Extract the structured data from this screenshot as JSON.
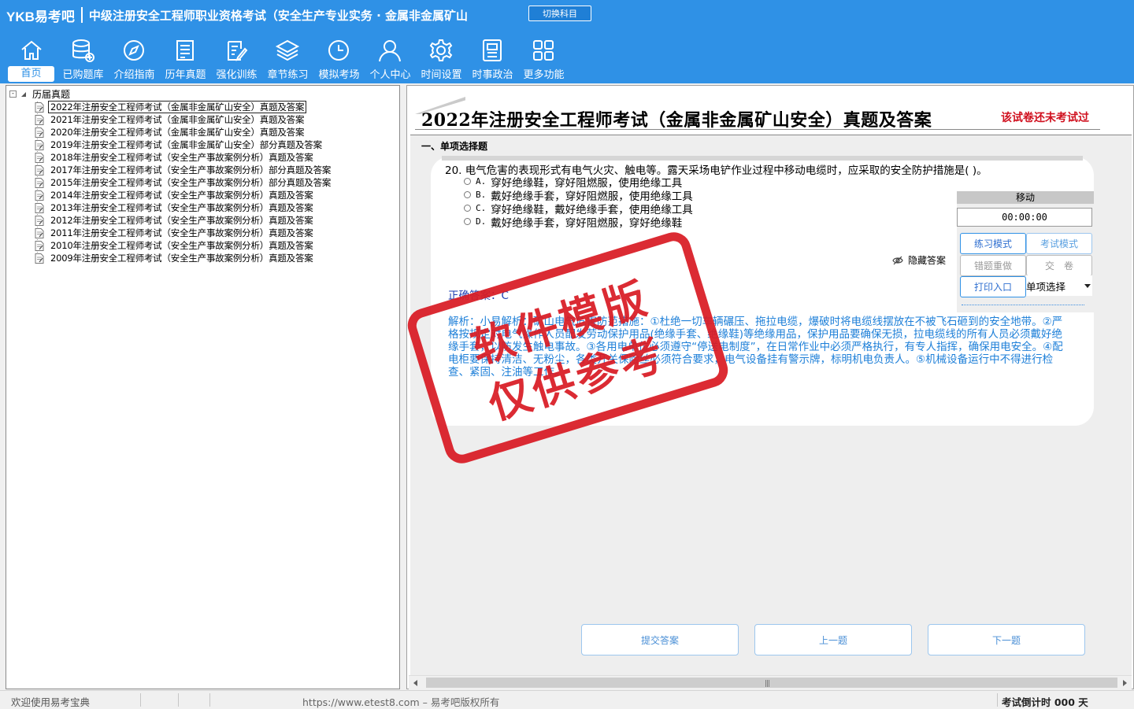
{
  "header": {
    "brand": "YKB易考吧",
    "app_title": "中级注册安全工程师职业资格考试（安全生产专业实务 · 金属非金属矿山",
    "switch_label": "切换科目",
    "colors": {
      "header_bg": "#2f91e6",
      "accent_red": "#d91b24"
    },
    "nav": [
      {
        "label": "首页",
        "icon": "home-icon"
      },
      {
        "label": "已购题库",
        "icon": "database-icon"
      },
      {
        "label": "介绍指南",
        "icon": "compass-icon"
      },
      {
        "label": "历年真题",
        "icon": "exam-sheet-icon"
      },
      {
        "label": "强化训练",
        "icon": "edit-icon"
      },
      {
        "label": "章节练习",
        "icon": "layers-icon"
      },
      {
        "label": "模拟考场",
        "icon": "clock-icon"
      },
      {
        "label": "个人中心",
        "icon": "user-icon"
      },
      {
        "label": "时间设置",
        "icon": "gear-icon"
      },
      {
        "label": "时事政治",
        "icon": "news-icon"
      },
      {
        "label": "更多功能",
        "icon": "grid-icon"
      }
    ]
  },
  "tree": {
    "root_label": "历届真题",
    "items": [
      "2022年注册安全工程师考试（金属非金属矿山安全）真题及答案",
      "2021年注册安全工程师考试（金属非金属矿山安全）真题及答案",
      "2020年注册安全工程师考试（金属非金属矿山安全）真题及答案",
      "2019年注册安全工程师考试（金属非金属矿山安全）部分真题及答案",
      "2018年注册安全工程师考试（安全生产事故案例分析）真题及答案",
      "2017年注册安全工程师考试（安全生产事故案例分析）部分真题及答案",
      "2015年注册安全工程师考试（安全生产事故案例分析）部分真题及答案",
      "2014年注册安全工程师考试（安全生产事故案例分析）真题及答案",
      "2013年注册安全工程师考试（安全生产事故案例分析）真题及答案",
      "2012年注册安全工程师考试（安全生产事故案例分析）真题及答案",
      "2011年注册安全工程师考试（安全生产事故案例分析）真题及答案",
      "2010年注册安全工程师考试（安全生产事故案例分析）真题及答案",
      "2009年注册安全工程师考试（安全生产事故案例分析）真题及答案"
    ]
  },
  "paper": {
    "title": "2022年注册安全工程师考试（金属非金属矿山安全）真题及答案",
    "status": "该试卷还未考试过",
    "section_title": "一、单项选择题"
  },
  "question": {
    "text": "20. 电气危害的表现形式有电气火灾、触电等。露天采场电铲作业过程中移动电缆时，应采取的安全防护措施是( )。",
    "options": [
      {
        "key": "A.",
        "text": "穿好绝缘鞋，穿好阻燃服，使用绝缘工具"
      },
      {
        "key": "B.",
        "text": "戴好绝缘手套，穿好阻燃服，使用绝缘工具"
      },
      {
        "key": "C.",
        "text": "穿好绝缘鞋，戴好绝缘手套，使用绝缘工具"
      },
      {
        "key": "D.",
        "text": "戴好绝缘手套，穿好阻燃服，穿好绝缘鞋"
      }
    ],
    "hide_answer_label": "隐藏答案",
    "correct_answer": "正确答案：C",
    "analysis": "解析：小易解析：矿山电气危害防范措施：①杜绝一切车辆碾压、拖拉电缆，爆破时将电缆线摆放在不被飞石砸到的安全地带。②严格按规定对电气操作人员配发劳动保护用品(绝缘手套、绝缘鞋)等绝缘用品，保护用品要确保无损，拉电缆线的所有人员必须戴好绝缘手套，以防发生触电事故。③各用电单位必须遵守“停送电制度”，在日常作业中必须严格执行，有专人指挥，确保用电安全。④配电柜要保持清洁、无粉尘，各类开关保险丝必须符合要求，电气设备挂有警示牌，标明机电负责人。⑤机械设备运行中不得进行检查、紧固、注油等工作。"
  },
  "tool_panel": {
    "move_label": "移动",
    "timer": "00:00:00",
    "practice_mode": "练习模式",
    "exam_mode": "考试模式",
    "redo_wrong": "错题重做",
    "submit_paper": "交　卷",
    "print_entry": "打印入口",
    "question_type": "单项选择"
  },
  "watermark": {
    "line1": "软件模版",
    "line2": "仅供参考"
  },
  "bottom_buttons": {
    "submit": "提交答案",
    "prev": "上一题",
    "next": "下一题"
  },
  "statusbar": {
    "welcome": "欢迎使用易考宝典",
    "copyright": "https://www.etest8.com – 易考吧版权所有",
    "countdown": "考试倒计时 000 天"
  }
}
